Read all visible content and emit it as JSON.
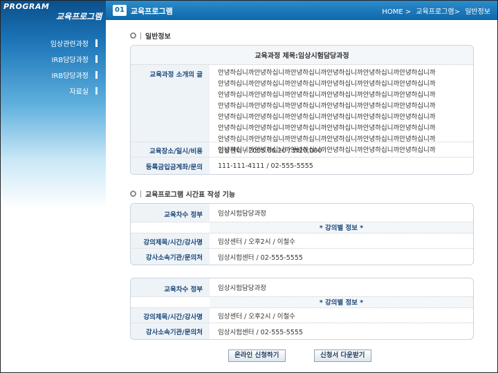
{
  "sidebar": {
    "brand_en": "PROGRAM",
    "brand_ko": "교육프로그램",
    "items": [
      {
        "label": "임상관련과정"
      },
      {
        "label": "IRB담당과정"
      },
      {
        "label": "IRB당당과정"
      },
      {
        "label": "자료실"
      }
    ]
  },
  "header": {
    "number": "01",
    "title": "교육프로그램",
    "breadcrumb": [
      "HOME >",
      "교육프로그램>",
      "일반정보"
    ]
  },
  "general": {
    "heading": "일반정보",
    "course_title": "교육과정 제목:임상시험담당과정",
    "intro_label": "교육과정 소개의 글",
    "intro_lines": [
      "안녕하십니까안녕하십니까안녕하십니까안녕하십니까안녕하십니까안녕하십니까",
      "안녕하십니까안녕하십니까안녕하십니까안녕하십니까안녕하십니까안녕하십니까",
      "안녕하십니까안녕하십니까안녕하십니까안녕하십니까안녕하십니까안녕하십니까",
      "안녕하십니까안녕하십니까안녕하십니까안녕하십니까안녕하십니까안녕하십니까",
      "안녕하십니까안녕하십니까안녕하십니까안녕하십니까안녕하십니까안녕하십니까",
      "안녕하십니까안녕하십니까안녕하십니까안녕하십니까안녕하십니까안녕하십니까",
      "안녕하십니까안녕하십니까안녕하십니까안녕하십니까안녕하십니까안녕하십니까",
      "안녕하십니까안녕하십니까안녕하십니까안녕하십니까안녕하십니까안녕하십니까"
    ],
    "place_label": "교육장소/일시/비용",
    "place_value": "임상센터 / 2005.06.20 / ₩20,000",
    "account_label": "등록금입금계좌/문의",
    "account_value": "111-111-4111 / 02-555-5555"
  },
  "timetable": {
    "heading": "교육프로그램 시간표 작성 기능",
    "tables": [
      {
        "session_label": "교육차수 정부",
        "session_value": "임상시험담당과정",
        "lecture_info": "* 강의별 정보 *",
        "lecture_label": "강의제목/시간/강사명",
        "lecture_value": "임상센터 / 오후2시 / 이철수",
        "org_label": "강사소속기관/문의처",
        "org_value": "임상시험센터 / 02-555-5555"
      },
      {
        "session_label": "교육차수 정부",
        "session_value": "임상시험담당과정",
        "lecture_info": "* 강의별 정보 *",
        "lecture_label": "강의제목/시간/강사명",
        "lecture_value": "임상센터 / 오후2시 / 이철수",
        "org_label": "강사소속기관/문의처",
        "org_value": "임상시험센터 / 02-555-5555"
      }
    ]
  },
  "buttons": {
    "apply_online": "온라인 신청하기",
    "download_form": "신청서 다운받기"
  },
  "colors": {
    "header_blue": "#0f67a8",
    "label_blue": "#1e4a7a",
    "border": "#c9d3dc"
  }
}
